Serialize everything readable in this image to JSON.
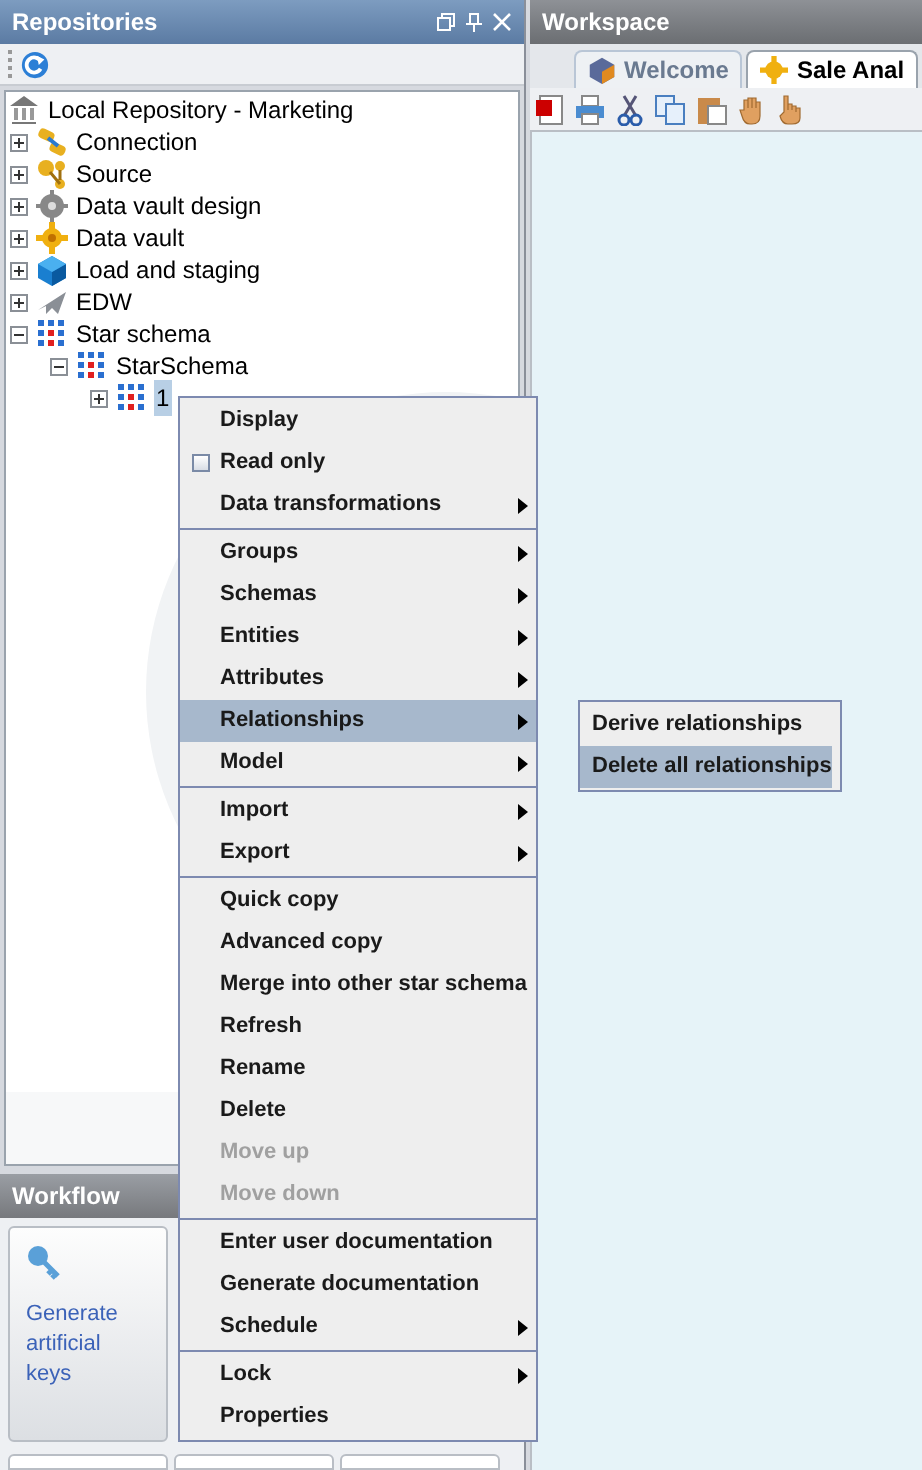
{
  "repositories": {
    "title": "Repositories",
    "tree": [
      {
        "label": "Local Repository - Marketing",
        "selected": false,
        "children": [
          {
            "label": "Connection",
            "expanded": false,
            "selected": false
          },
          {
            "label": "Source",
            "expanded": false,
            "selected": false
          },
          {
            "label": "Data vault design",
            "expanded": false,
            "selected": false
          },
          {
            "label": "Data vault",
            "expanded": false,
            "selected": false
          },
          {
            "label": "Load and staging",
            "expanded": false,
            "selected": false
          },
          {
            "label": "EDW",
            "expanded": false,
            "selected": false
          },
          {
            "label": "Star schema",
            "expanded": true,
            "selected": false,
            "children": [
              {
                "label": "StarSchema",
                "expanded": true,
                "selected": false,
                "children": [
                  {
                    "label": "1",
                    "expanded": false,
                    "selected": true
                  }
                ]
              }
            ]
          }
        ]
      }
    ]
  },
  "workflow": {
    "title": "Workflow",
    "card": "Generate artificial keys"
  },
  "workspace": {
    "title": "Workspace",
    "tabs": [
      {
        "label": "Welcome",
        "selected": false
      },
      {
        "label": "Sale Anal",
        "selected": true
      }
    ]
  },
  "context_menu": [
    {
      "kind": "item",
      "label": "Display",
      "disabled": false,
      "selected": false
    },
    {
      "kind": "checkbox",
      "label": "Read only",
      "checked": false,
      "disabled": false,
      "selected": false
    },
    {
      "kind": "submenu",
      "label": "Data transformations",
      "disabled": false,
      "selected": false
    },
    {
      "kind": "separator"
    },
    {
      "kind": "submenu",
      "label": "Groups",
      "disabled": false,
      "selected": false
    },
    {
      "kind": "submenu",
      "label": "Schemas",
      "disabled": false,
      "selected": false
    },
    {
      "kind": "submenu",
      "label": "Entities",
      "disabled": false,
      "selected": false
    },
    {
      "kind": "submenu",
      "label": "Attributes",
      "disabled": false,
      "selected": false
    },
    {
      "kind": "submenu",
      "label": "Relationships",
      "disabled": false,
      "selected": true
    },
    {
      "kind": "submenu",
      "label": "Model",
      "disabled": false,
      "selected": false
    },
    {
      "kind": "separator"
    },
    {
      "kind": "submenu",
      "label": "Import",
      "disabled": false,
      "selected": false
    },
    {
      "kind": "submenu",
      "label": "Export",
      "disabled": false,
      "selected": false
    },
    {
      "kind": "separator"
    },
    {
      "kind": "item",
      "label": "Quick copy",
      "disabled": false,
      "selected": false
    },
    {
      "kind": "item",
      "label": "Advanced copy",
      "disabled": false,
      "selected": false
    },
    {
      "kind": "item",
      "label": "Merge into other star schema",
      "disabled": false,
      "selected": false
    },
    {
      "kind": "item",
      "label": "Refresh",
      "disabled": false,
      "selected": false
    },
    {
      "kind": "item",
      "label": "Rename",
      "disabled": false,
      "selected": false
    },
    {
      "kind": "item",
      "label": "Delete",
      "disabled": false,
      "selected": false
    },
    {
      "kind": "item",
      "label": "Move up",
      "disabled": true,
      "selected": false
    },
    {
      "kind": "item",
      "label": "Move down",
      "disabled": true,
      "selected": false
    },
    {
      "kind": "separator"
    },
    {
      "kind": "item",
      "label": "Enter user documentation",
      "disabled": false,
      "selected": false
    },
    {
      "kind": "item",
      "label": "Generate documentation",
      "disabled": false,
      "selected": false
    },
    {
      "kind": "submenu",
      "label": "Schedule",
      "disabled": false,
      "selected": false
    },
    {
      "kind": "separator"
    },
    {
      "kind": "submenu",
      "label": "Lock",
      "disabled": false,
      "selected": false
    },
    {
      "kind": "item",
      "label": "Properties",
      "disabled": false,
      "selected": false
    }
  ],
  "submenu": [
    {
      "label": "Derive relationships",
      "selected": false
    },
    {
      "label": "Delete all relationships",
      "selected": true
    }
  ]
}
